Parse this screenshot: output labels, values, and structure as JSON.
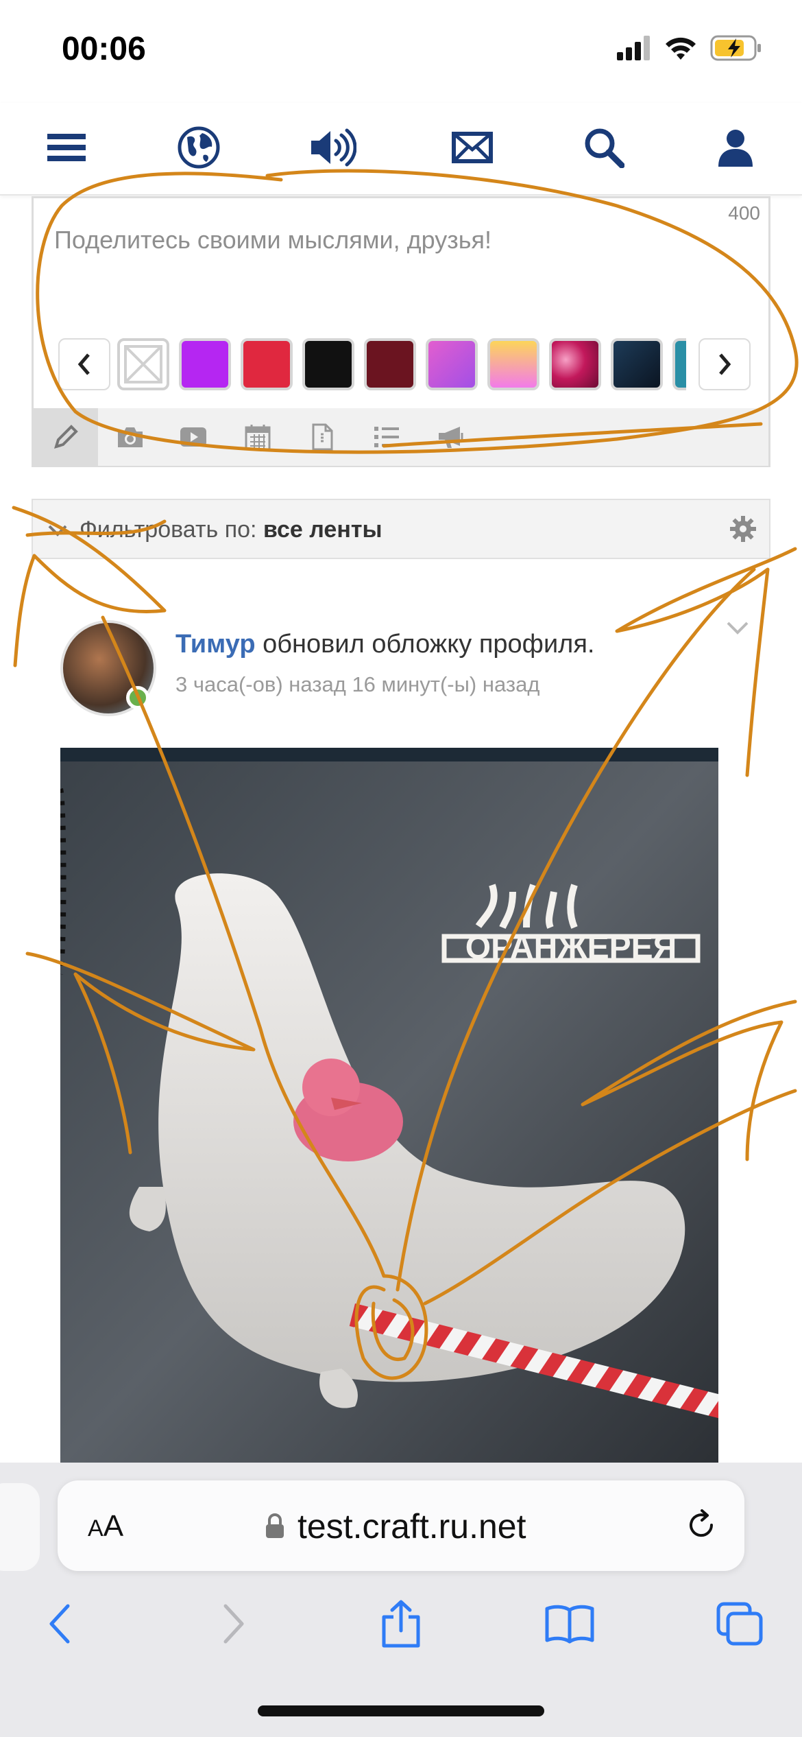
{
  "status_bar": {
    "time": "00:06"
  },
  "nav": {
    "icons": [
      "menu-icon",
      "globe-icon",
      "speaker-icon",
      "mail-icon",
      "search-icon",
      "user-icon"
    ]
  },
  "composer": {
    "char_count": "400",
    "placeholder": "Поделитесь своими мыслями, друзья!",
    "background_swatches": [
      "#ffffff",
      "#b526f2",
      "#e0283f",
      "#111111",
      "#6b1420",
      "#c85ee0",
      "#f79be6",
      "#c2185b",
      "#0b2337",
      "#2a8fa6"
    ],
    "tools": [
      "pencil-icon",
      "camera-icon",
      "video-icon",
      "calendar-icon",
      "file-icon",
      "list-icon",
      "megaphone-icon"
    ]
  },
  "filter": {
    "label": "Фильтровать по:",
    "value": "все ленты"
  },
  "post": {
    "author": "Тимур",
    "action": " обновил обложку профиля.",
    "time": "3 часа(-ов) назад 16 минут(-ы) назад",
    "image_sign": "ОРАНЖЕРЕЯ"
  },
  "browser": {
    "aa_small": "A",
    "aa_large": "A",
    "url": "test.craft.ru.net"
  },
  "colors": {
    "nav_icon": "#1a3b78",
    "link": "#3b6cb5",
    "annotation": "#d4861a",
    "ios_blue": "#2f7cf6"
  }
}
